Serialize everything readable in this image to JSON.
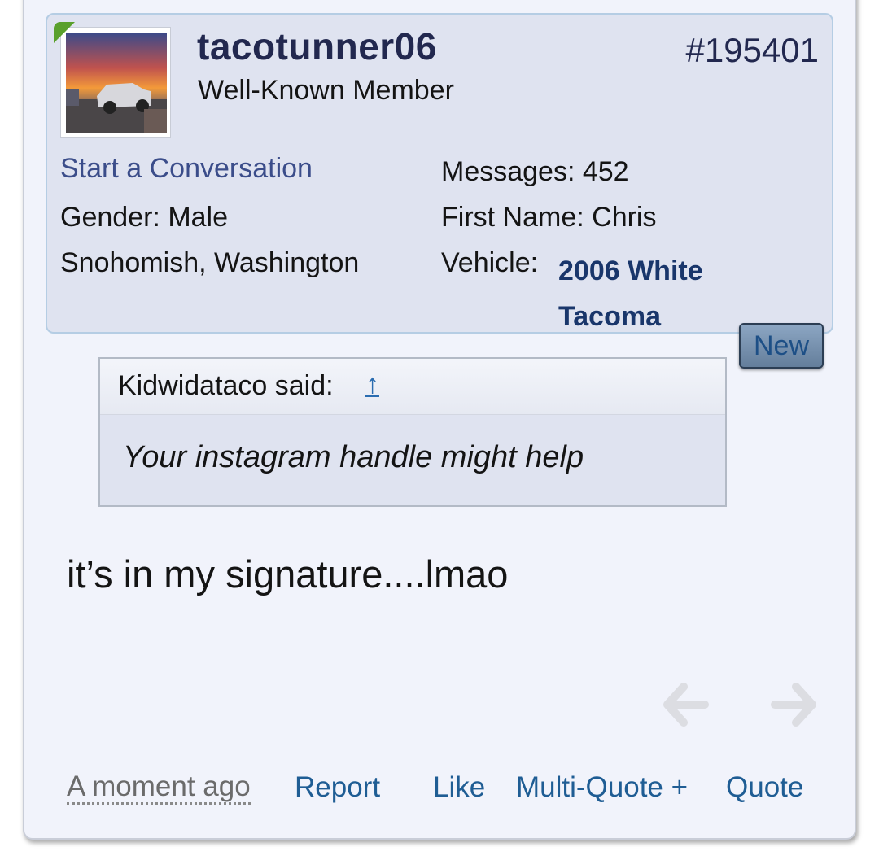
{
  "user": {
    "username": "tacotunner06",
    "title": "Well-Known Member",
    "start_conversation": "Start a Conversation",
    "gender_label": "Gender:",
    "gender_value": "Male",
    "location": "Snohomish, Washington",
    "messages_label": "Messages:",
    "messages_value": "452",
    "first_name_label": "First Name:",
    "first_name_value": "Chris",
    "vehicle_label": "Vehicle:",
    "vehicle_value": "2006 White Tacoma"
  },
  "post": {
    "number": "#195401",
    "new_badge": "New",
    "message": "it’s in my signature....lmao",
    "timestamp": "A moment ago"
  },
  "quote": {
    "author": "Kidwidataco said:",
    "jump_icon": "↑",
    "text": "Your instagram handle might help"
  },
  "actions": {
    "report": "Report",
    "like": "Like",
    "multiquote": "Multi-Quote +",
    "quote": "Quote"
  },
  "colors": {
    "username": "#22284f",
    "link": "#1f5d94",
    "vehicle": "#19366b",
    "online": "#5aa02c"
  }
}
